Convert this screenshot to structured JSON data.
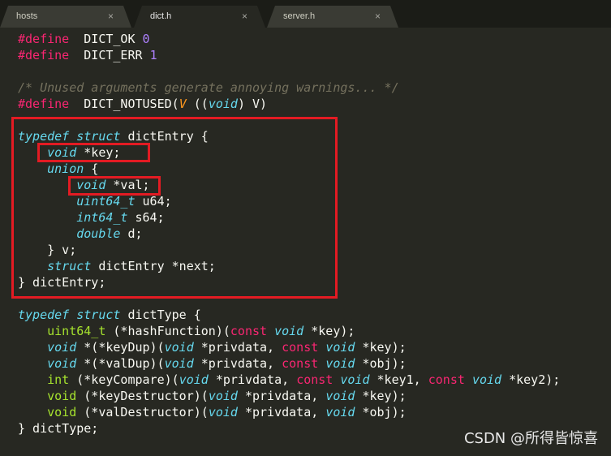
{
  "tabs": [
    {
      "label": "hosts",
      "close": "×"
    },
    {
      "label": "dict.h",
      "close": "×"
    },
    {
      "label": "server.h",
      "close": "×"
    }
  ],
  "code": [
    [
      [
        "pp",
        "#define"
      ],
      [
        "",
        "  DICT_OK "
      ],
      [
        "num",
        "0"
      ]
    ],
    [
      [
        "pp",
        "#define"
      ],
      [
        "",
        "  DICT_ERR "
      ],
      [
        "num",
        "1"
      ]
    ],
    [],
    [
      [
        "cm",
        "/* Unused arguments generate annoying warnings... */"
      ]
    ],
    [
      [
        "pp",
        "#define"
      ],
      [
        "",
        "  DICT_NOTUSED("
      ],
      [
        "pr",
        "V"
      ],
      [
        "",
        " (("
      ],
      [
        "ty",
        "void"
      ],
      [
        "",
        ") V)"
      ]
    ],
    [],
    [
      [
        "kw",
        "typedef"
      ],
      [
        "",
        " "
      ],
      [
        "kw",
        "struct"
      ],
      [
        "",
        " dictEntry {"
      ]
    ],
    [
      [
        "",
        "    "
      ],
      [
        "ty",
        "void"
      ],
      [
        "",
        " *key;"
      ]
    ],
    [
      [
        "",
        "    "
      ],
      [
        "kw",
        "union"
      ],
      [
        "",
        " {"
      ]
    ],
    [
      [
        "",
        "        "
      ],
      [
        "ty",
        "void"
      ],
      [
        "",
        " *val;"
      ]
    ],
    [
      [
        "",
        "        "
      ],
      [
        "ty",
        "uint64_t"
      ],
      [
        "",
        " u64;"
      ]
    ],
    [
      [
        "",
        "        "
      ],
      [
        "ty",
        "int64_t"
      ],
      [
        "",
        " s64;"
      ]
    ],
    [
      [
        "",
        "        "
      ],
      [
        "ty",
        "double"
      ],
      [
        "",
        " d;"
      ]
    ],
    [
      [
        "",
        "    } v;"
      ]
    ],
    [
      [
        "",
        "    "
      ],
      [
        "kw",
        "struct"
      ],
      [
        "",
        " dictEntry *next;"
      ]
    ],
    [
      [
        "",
        "} dictEntry;"
      ]
    ],
    [],
    [
      [
        "kw",
        "typedef"
      ],
      [
        "",
        " "
      ],
      [
        "kw",
        "struct"
      ],
      [
        "",
        " dictType {"
      ]
    ],
    [
      [
        "",
        "    "
      ],
      [
        "tn",
        "uint64_t"
      ],
      [
        "",
        " (*hashFunction)("
      ],
      [
        "sk",
        "const"
      ],
      [
        "",
        " "
      ],
      [
        "ty",
        "void"
      ],
      [
        "",
        " *key);"
      ]
    ],
    [
      [
        "",
        "    "
      ],
      [
        "ty",
        "void"
      ],
      [
        "",
        " *(*keyDup)("
      ],
      [
        "ty",
        "void"
      ],
      [
        "",
        " *privdata, "
      ],
      [
        "sk",
        "const"
      ],
      [
        "",
        " "
      ],
      [
        "ty",
        "void"
      ],
      [
        "",
        " *key);"
      ]
    ],
    [
      [
        "",
        "    "
      ],
      [
        "ty",
        "void"
      ],
      [
        "",
        " *(*valDup)("
      ],
      [
        "ty",
        "void"
      ],
      [
        "",
        " *privdata, "
      ],
      [
        "sk",
        "const"
      ],
      [
        "",
        " "
      ],
      [
        "ty",
        "void"
      ],
      [
        "",
        " *obj);"
      ]
    ],
    [
      [
        "",
        "    "
      ],
      [
        "tn",
        "int"
      ],
      [
        "",
        " (*keyCompare)("
      ],
      [
        "ty",
        "void"
      ],
      [
        "",
        " *privdata, "
      ],
      [
        "sk",
        "const"
      ],
      [
        "",
        " "
      ],
      [
        "ty",
        "void"
      ],
      [
        "",
        " *key1, "
      ],
      [
        "sk",
        "const"
      ],
      [
        "",
        " "
      ],
      [
        "ty",
        "void"
      ],
      [
        "",
        " *key2);"
      ]
    ],
    [
      [
        "",
        "    "
      ],
      [
        "tn",
        "void"
      ],
      [
        "",
        " (*keyDestructor)("
      ],
      [
        "ty",
        "void"
      ],
      [
        "",
        " *privdata, "
      ],
      [
        "ty",
        "void"
      ],
      [
        "",
        " *key);"
      ]
    ],
    [
      [
        "",
        "    "
      ],
      [
        "tn",
        "void"
      ],
      [
        "",
        " (*valDestructor)("
      ],
      [
        "ty",
        "void"
      ],
      [
        "",
        " *privdata, "
      ],
      [
        "ty",
        "void"
      ],
      [
        "",
        " *obj);"
      ]
    ],
    [
      [
        "",
        "} dictType;"
      ]
    ]
  ],
  "highlight_color": "#e31b23",
  "watermark": "CSDN @所得皆惊喜"
}
